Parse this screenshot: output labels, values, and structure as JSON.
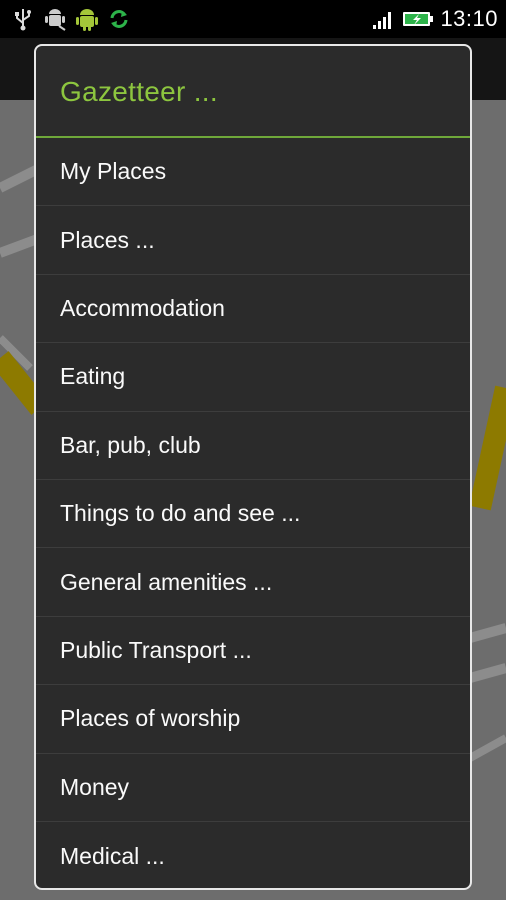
{
  "status_bar": {
    "left_icons": [
      "usb-icon",
      "android-debug-icon",
      "android-icon",
      "sync-icon"
    ],
    "signal_icon": "signal-bars-icon",
    "battery_icon": "battery-charging-icon",
    "clock": "13:10",
    "colors": {
      "accent": "#2db34a"
    }
  },
  "dialog": {
    "title": "Gazetteer ...",
    "title_color": "#8dc63f",
    "items": [
      {
        "label": "My Places"
      },
      {
        "label": "Places ..."
      },
      {
        "label": "Accommodation"
      },
      {
        "label": "Eating"
      },
      {
        "label": "Bar, pub, club"
      },
      {
        "label": "Things to do and see ..."
      },
      {
        "label": "General amenities ..."
      },
      {
        "label": "Public Transport ..."
      },
      {
        "label": "Places of worship"
      },
      {
        "label": "Money"
      },
      {
        "label": "Medical ..."
      }
    ]
  }
}
